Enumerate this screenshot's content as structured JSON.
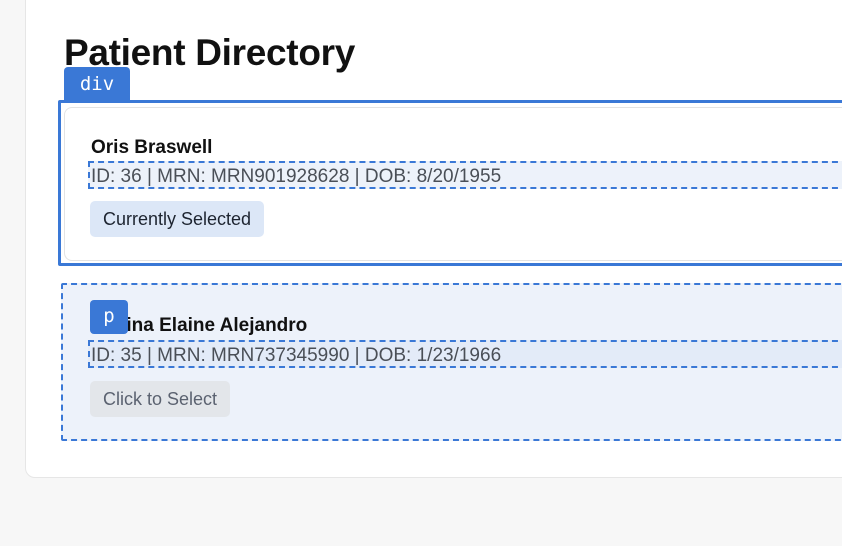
{
  "page": {
    "title": "Patient Directory"
  },
  "patients": [
    {
      "name": "Oris Braswell",
      "meta": "ID: 36 | MRN: MRN901928628 | DOB: 8/20/1955",
      "action_label": "Currently Selected"
    },
    {
      "name": "Marina Elaine Alejandro",
      "visible_name": "rina Elaine Alejandro",
      "meta": "ID: 35 | MRN: MRN737345990 | DOB: 1/23/1966",
      "action_label": "Click to Select"
    }
  ],
  "inspector": {
    "selected_tag": "div",
    "hover_tag": "p"
  },
  "colors": {
    "accent": "#3a78d6",
    "selected_pill_bg": "#dce7f7",
    "hover_card_bg": "#edf2fa"
  }
}
